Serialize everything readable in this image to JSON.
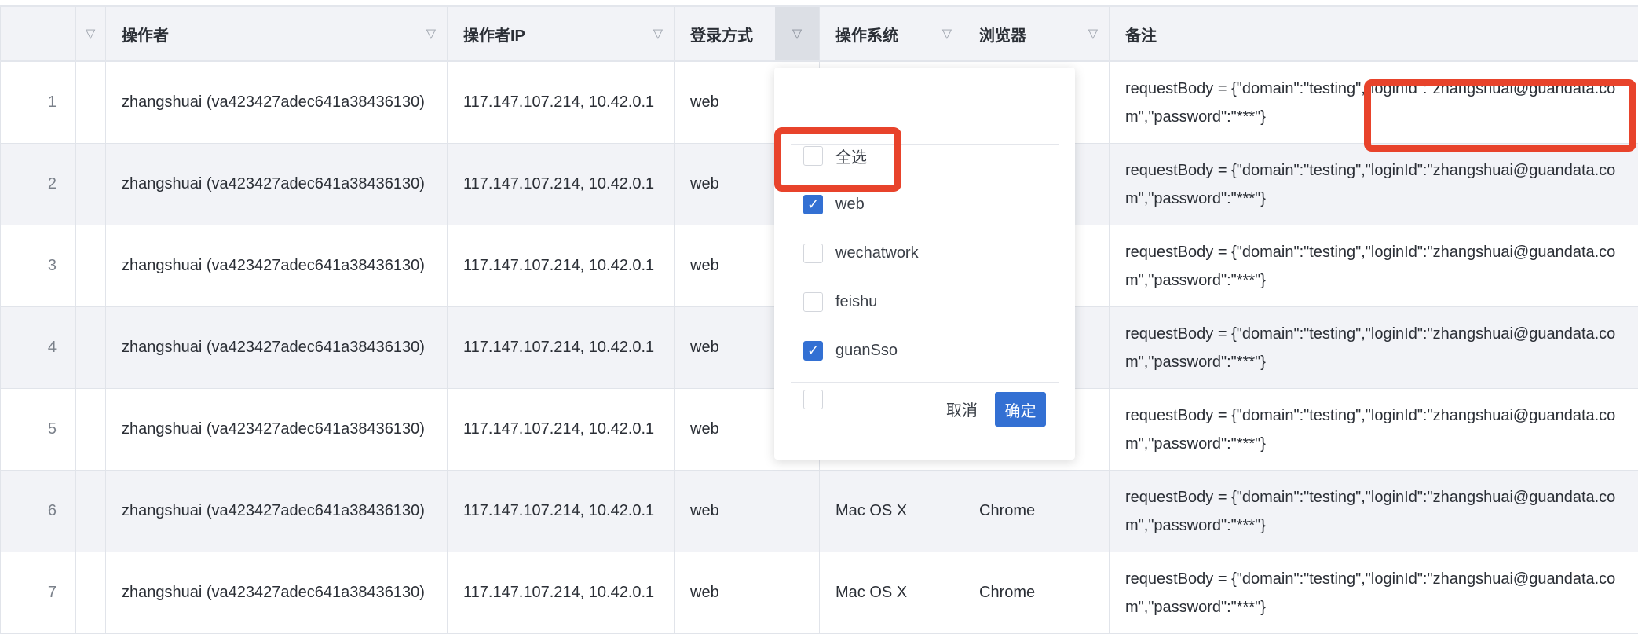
{
  "columns": [
    {
      "label": "",
      "filter_icon": "filter-icon"
    },
    {
      "label": "",
      "filter_icon": "filter-icon"
    },
    {
      "label": "操作者",
      "filter_icon": "filter-icon"
    },
    {
      "label": "操作者IP",
      "filter_icon": "filter-icon"
    },
    {
      "label": "登录方式",
      "filter_icon": "filter-icon",
      "filter_active": true
    },
    {
      "label": "操作系统",
      "filter_icon": "filter-icon"
    },
    {
      "label": "浏览器",
      "filter_icon": "filter-icon"
    },
    {
      "label": "备注"
    }
  ],
  "rows": [
    {
      "index": "1",
      "operator": "zhangshuai (va423427adec641a38436130)",
      "ip": "117.147.107.214, 10.42.0.1",
      "login": "web",
      "os": "",
      "browser": "",
      "note": "requestBody = {\"domain\":\"testing\",\"loginId\":\"zhangshuai@guandata.com\",\"password\":\"***\"}"
    },
    {
      "index": "2",
      "operator": "zhangshuai (va423427adec641a38436130)",
      "ip": "117.147.107.214, 10.42.0.1",
      "login": "web",
      "os": "",
      "browser": "",
      "note": "requestBody = {\"domain\":\"testing\",\"loginId\":\"zhangshuai@guandata.com\",\"password\":\"***\"}"
    },
    {
      "index": "3",
      "operator": "zhangshuai (va423427adec641a38436130)",
      "ip": "117.147.107.214, 10.42.0.1",
      "login": "web",
      "os": "",
      "browser": "",
      "note": "requestBody = {\"domain\":\"testing\",\"loginId\":\"zhangshuai@guandata.com\",\"password\":\"***\"}"
    },
    {
      "index": "4",
      "operator": "zhangshuai (va423427adec641a38436130)",
      "ip": "117.147.107.214, 10.42.0.1",
      "login": "web",
      "os": "",
      "browser": "",
      "note": "requestBody = {\"domain\":\"testing\",\"loginId\":\"zhangshuai@guandata.com\",\"password\":\"***\"}"
    },
    {
      "index": "5",
      "operator": "zhangshuai (va423427adec641a38436130)",
      "ip": "117.147.107.214, 10.42.0.1",
      "login": "web",
      "os": "",
      "browser": "",
      "note": "requestBody = {\"domain\":\"testing\",\"loginId\":\"zhangshuai@guandata.com\",\"password\":\"***\"}"
    },
    {
      "index": "6",
      "operator": "zhangshuai (va423427adec641a38436130)",
      "ip": "117.147.107.214, 10.42.0.1",
      "login": "web",
      "os": "Mac OS X",
      "browser": "Chrome",
      "note": "requestBody = {\"domain\":\"testing\",\"loginId\":\"zhangshuai@guandata.com\",\"password\":\"***\"}"
    },
    {
      "index": "7",
      "operator": "zhangshuai (va423427adec641a38436130)",
      "ip": "117.147.107.214, 10.42.0.1",
      "login": "web",
      "os": "Mac OS X",
      "browser": "Chrome",
      "note": "requestBody = {\"domain\":\"testing\",\"loginId\":\"zhangshuai@guandata.com\",\"password\":\"***\"}"
    }
  ],
  "filter_dropdown": {
    "select_all": {
      "label": "全选",
      "checked": false
    },
    "options": [
      {
        "label": "web",
        "checked": true
      },
      {
        "label": "wechatwork",
        "checked": false
      },
      {
        "label": "feishu",
        "checked": false
      },
      {
        "label": "guanSso",
        "checked": true
      },
      {
        "label": "",
        "checked": false
      }
    ],
    "cancel_label": "取消",
    "confirm_label": "确定"
  },
  "colors": {
    "accent": "#3370d3",
    "highlight": "#e8432b",
    "header_bg": "#f2f3f7"
  }
}
